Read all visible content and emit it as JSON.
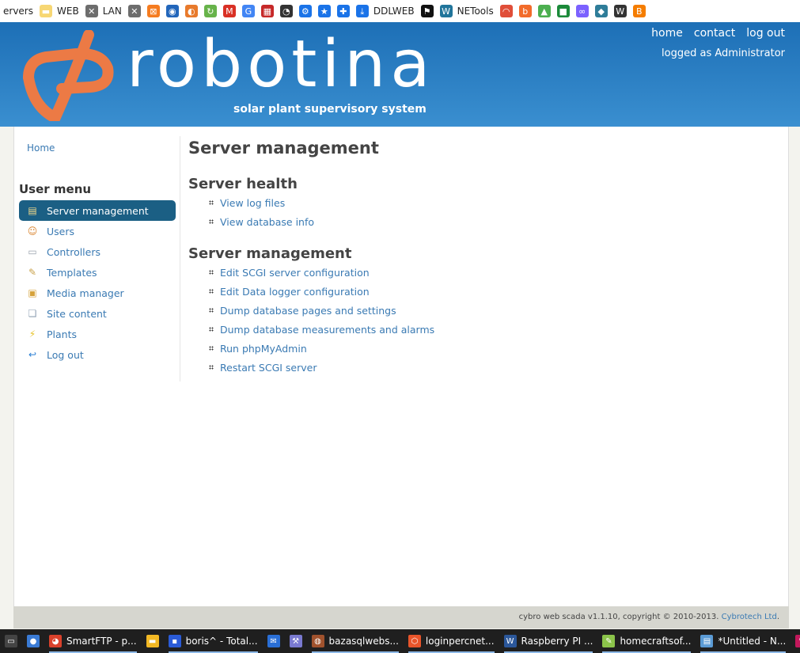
{
  "bookmarks": [
    {
      "label": "ervers",
      "icon": "folder-icon",
      "color": "#ffffff"
    },
    {
      "label": "WEB",
      "icon": "folder-icon",
      "color": "#f7d774"
    },
    {
      "label": "LAN",
      "icon": "network-icon",
      "color": "#6d6d6d"
    },
    {
      "label": "",
      "icon": "network-icon",
      "color": "#6d6d6d"
    },
    {
      "label": "",
      "icon": "xampp-icon",
      "color": "#f57c20"
    },
    {
      "label": "",
      "icon": "broadcast-icon",
      "color": "#2266bb"
    },
    {
      "label": "",
      "icon": "circle-icon",
      "color": "#e87a2c"
    },
    {
      "label": "",
      "icon": "refresh-icon",
      "color": "#67b34a"
    },
    {
      "label": "",
      "icon": "gmail-icon",
      "color": "#d93025"
    },
    {
      "label": "",
      "icon": "translate-icon",
      "color": "#4285f4"
    },
    {
      "label": "",
      "icon": "calendar-icon",
      "color": "#c62828"
    },
    {
      "label": "",
      "icon": "speedometer-icon",
      "color": "#333333"
    },
    {
      "label": "",
      "icon": "gear-icon",
      "color": "#1a73e8"
    },
    {
      "label": "",
      "icon": "star-icon",
      "color": "#1a73e8"
    },
    {
      "label": "",
      "icon": "puzzle-icon",
      "color": "#1a73e8"
    },
    {
      "label": "DDLWEB",
      "icon": "download-icon",
      "color": "#1a73e8"
    },
    {
      "label": "",
      "icon": "flag-icon",
      "color": "#111111"
    },
    {
      "label": "NETools",
      "icon": "wordpress-icon",
      "color": "#21759b"
    },
    {
      "label": "",
      "icon": "rainbow-icon",
      "color": "#e04e39"
    },
    {
      "label": "",
      "icon": "b-logo-icon",
      "color": "#f26b2a"
    },
    {
      "label": "",
      "icon": "triangle-icon",
      "color": "#4caf50"
    },
    {
      "label": "",
      "icon": "lock-icon",
      "color": "#1b8a3a"
    },
    {
      "label": "",
      "icon": "infinity-icon",
      "color": "#7b61ff"
    },
    {
      "label": "",
      "icon": "cube-icon",
      "color": "#2e7d99"
    },
    {
      "label": "",
      "icon": "w-logo-icon",
      "color": "#333333"
    },
    {
      "label": "",
      "icon": "blogger-icon",
      "color": "#f57d00"
    }
  ],
  "header": {
    "brand": "robotina",
    "tagline": "solar plant supervisory system",
    "links": [
      "home",
      "contact",
      "log out"
    ],
    "logged_as": "logged as Administrator",
    "logo_color": "#ec7a45"
  },
  "sidebar": {
    "home": "Home",
    "menu_title": "User menu",
    "items": [
      {
        "label": "Server management",
        "icon": "server-settings-icon",
        "active": true
      },
      {
        "label": "Users",
        "icon": "users-icon"
      },
      {
        "label": "Controllers",
        "icon": "controller-icon"
      },
      {
        "label": "Templates",
        "icon": "template-icon"
      },
      {
        "label": "Media manager",
        "icon": "media-icon"
      },
      {
        "label": "Site content",
        "icon": "content-icon"
      },
      {
        "label": "Plants",
        "icon": "lightning-icon"
      },
      {
        "label": "Log out",
        "icon": "logout-arrow-icon"
      }
    ]
  },
  "main": {
    "title": "Server management",
    "sections": [
      {
        "title": "Server health",
        "links": [
          "View log files",
          "View database info"
        ]
      },
      {
        "title": "Server management",
        "links": [
          "Edit SCGI server configuration",
          "Edit Data logger configuration",
          "Dump database pages and settings",
          "Dump database measurements and alarms",
          "Run phpMyAdmin",
          "Restart SCGI server"
        ]
      }
    ]
  },
  "footer": {
    "text": "cybro web scada v1.1.10, copyright © 2010-2013.",
    "link": "Cybrotech Ltd",
    "period": "."
  },
  "taskbar": [
    {
      "label": "",
      "icon": "terminal-icon",
      "color": "#444444"
    },
    {
      "label": "",
      "icon": "globe-network-icon",
      "color": "#3a7bd5"
    },
    {
      "label": "SmartFTP - p...",
      "icon": "smartftp-icon",
      "color": "#d9412b",
      "running": true
    },
    {
      "label": "",
      "icon": "file-explorer-icon",
      "color": "#f2b824"
    },
    {
      "label": "boris^ - Total...",
      "icon": "floppy-icon",
      "color": "#2a5bd7",
      "running": true
    },
    {
      "label": "",
      "icon": "mail-icon",
      "color": "#2a6fd6"
    },
    {
      "label": "",
      "icon": "tool-icon",
      "color": "#7a7ad0"
    },
    {
      "label": "bazasqlwebs...",
      "icon": "chrome-icon",
      "color": "#a0522d",
      "running": true
    },
    {
      "label": "loginpercnet...",
      "icon": "brave-icon",
      "color": "#e8552b",
      "running": true
    },
    {
      "label": "Raspberry PI ...",
      "icon": "word-icon",
      "color": "#2b579a",
      "running": true
    },
    {
      "label": "homecraftsof...",
      "icon": "notepad-plus-icon",
      "color": "#8bc34a",
      "running": true
    },
    {
      "label": "*Untitled - N...",
      "icon": "notepad-icon",
      "color": "#5b9bd5",
      "running": true
    },
    {
      "label": "",
      "icon": "notes-icon",
      "color": "#c2185b"
    }
  ]
}
